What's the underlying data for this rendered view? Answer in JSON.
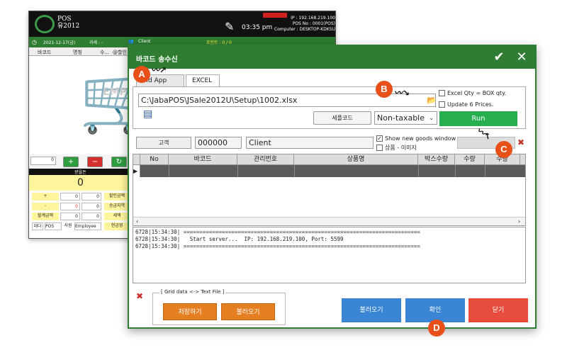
{
  "background_window": {
    "logo_line1": "POS",
    "logo_line2": "유2012",
    "ip": "IP : 192.168.219.100",
    "pos_no": "POS No : 0001(POS)",
    "computer": "Computer : DESKTOP-KDK5U",
    "time": "03:35 pm",
    "date": "2021-12-17(금)",
    "cashier": "과세 : -",
    "client": "Client",
    "counter": "포인트 : 0 / 0",
    "col_barcode": "바코드",
    "col_name": "명칭",
    "col_qty": "수...",
    "col_disc": "@할인",
    "watermark": "EMP",
    "amount_label": "받을돈",
    "amount": "0",
    "rows": [
      {
        "sign": "+",
        "v1": "0",
        "v2": "0",
        "label": "할인금액"
      },
      {
        "sign": "-",
        "v1": "0",
        "v2": "0",
        "label": "승금지역"
      },
      {
        "sign": "할계금액",
        "v1": "0",
        "v2": "0",
        "label": "세액"
      },
      {
        "sign": "대다",
        "v1": "POS",
        "v2": "사원",
        "v3": "Employee",
        "label": "현금영"
      }
    ],
    "qty_field": "0"
  },
  "dialog": {
    "title": "바코드 송수신",
    "tabs": [
      "oid App",
      "EXCEL"
    ],
    "file_path": "C:\\JabaPOS\\JSale2012U\\Setup\\1002.xlsx",
    "excel_qty_label": "Excel Qty = BOX qty.",
    "update_prices_label": "Update 6 Prices.",
    "sample_code_btn": "세플코드",
    "tax_select": "Non-taxable",
    "run_btn": "Run",
    "customer_btn": "고객",
    "customer_code": "000000",
    "customer_name": "Client",
    "show_new_goods": "Show new goods window",
    "goods_image": "상품 - 이미지",
    "grid_headers": [
      "No",
      "바코드",
      "관리번호",
      "상품명",
      "박스수량",
      "수량",
      "수량"
    ],
    "log_lines": [
      "6728|15:34:30| ==========================================================================",
      "6728|15:34:30|   Start server...  IP: 192.168.219.100, Port: 5599",
      "6728|15:34:30| =========================================================================="
    ],
    "group_label": "[ Grid data <-> Text File ]",
    "save_btn": "저장하기",
    "load_btn": "불러오기",
    "load2_btn": "불러오기",
    "confirm_btn": "확인",
    "close_btn": "닫기"
  },
  "markers": {
    "a": "A",
    "b": "B",
    "c": "C",
    "d": "D"
  },
  "colors": {
    "green": "#2e7d32",
    "run": "#27ae4f",
    "orange": "#e67e22",
    "blue": "#3a86d4",
    "red": "#e74c3c",
    "marker": "#e8501a"
  }
}
